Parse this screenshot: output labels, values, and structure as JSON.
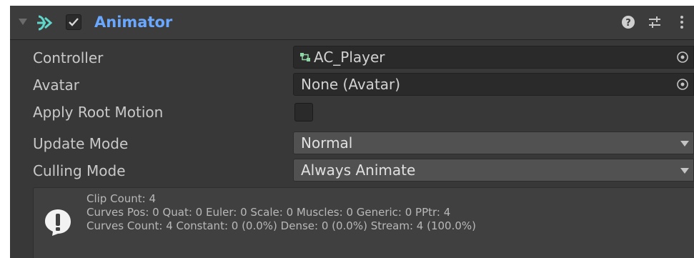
{
  "component": {
    "title": "Animator",
    "enabled": true,
    "icon": "animator-icon",
    "header_buttons": [
      "help-icon",
      "presets-icon",
      "more-options-icon"
    ]
  },
  "properties": {
    "controller": {
      "label": "Controller",
      "value": "AC_Player",
      "icon": "animator-controller-icon"
    },
    "avatar": {
      "label": "Avatar",
      "value": "None (Avatar)"
    },
    "apply_root_motion": {
      "label": "Apply Root Motion",
      "checked": false
    },
    "update_mode": {
      "label": "Update Mode",
      "value": "Normal"
    },
    "culling_mode": {
      "label": "Culling Mode",
      "value": "Always Animate"
    }
  },
  "info": {
    "icon": "info-exclamation-icon",
    "lines": [
      "Clip Count: 4",
      "Curves Pos: 0 Quat: 0 Euler: 0 Scale: 0 Muscles: 0 Generic: 0 PPtr: 4",
      "Curves Count: 4 Constant: 0 (0.0%) Dense: 0 (0.0%) Stream: 4 (100.0%)"
    ]
  },
  "colors": {
    "title": "#6aa8ff",
    "panel_bg": "#383838",
    "field_bg": "#2a2a2a",
    "dropdown_bg": "#515151"
  }
}
